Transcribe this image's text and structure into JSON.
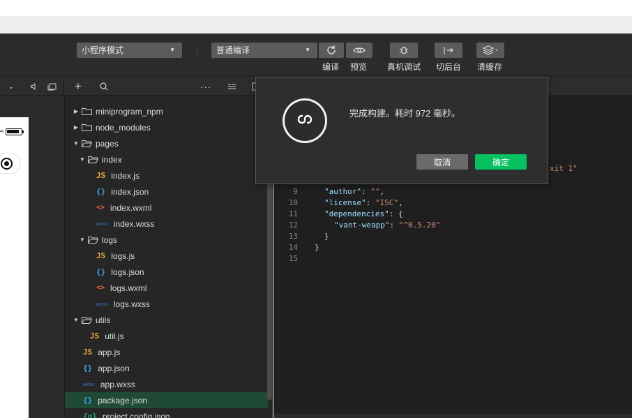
{
  "toolbar": {
    "mode_select": "小程序模式",
    "compile_select": "普通编译",
    "labels": {
      "compile": "编译",
      "preview": "预览",
      "remote_debug": "真机调试",
      "background": "切后台",
      "clear_cache": "清缓存"
    }
  },
  "tree": {
    "items": [
      {
        "label": "miniprogram_npm",
        "type": "folder",
        "expanded": false
      },
      {
        "label": "node_modules",
        "type": "folder",
        "expanded": false
      },
      {
        "label": "pages",
        "type": "folder",
        "expanded": true
      },
      {
        "label": "index",
        "type": "folder",
        "expanded": true
      },
      {
        "label": "index.js",
        "type": "js",
        "icon_text": "JS"
      },
      {
        "label": "index.json",
        "type": "json",
        "icon_text": "{}"
      },
      {
        "label": "index.wxml",
        "type": "wxml",
        "icon_text": "<>"
      },
      {
        "label": "index.wxss",
        "type": "wxss",
        "icon_text": "wxss"
      },
      {
        "label": "logs",
        "type": "folder",
        "expanded": true
      },
      {
        "label": "logs.js",
        "type": "js",
        "icon_text": "JS"
      },
      {
        "label": "logs.json",
        "type": "json",
        "icon_text": "{}"
      },
      {
        "label": "logs.wxml",
        "type": "wxml",
        "icon_text": "<>"
      },
      {
        "label": "logs.wxss",
        "type": "wxss",
        "icon_text": "wxss"
      },
      {
        "label": "utils",
        "type": "folder",
        "expanded": true
      },
      {
        "label": "util.js",
        "type": "js",
        "icon_text": "JS"
      },
      {
        "label": "app.js",
        "type": "js",
        "icon_text": "JS"
      },
      {
        "label": "app.json",
        "type": "json",
        "icon_text": "{}"
      },
      {
        "label": "app.wxss",
        "type": "wxss",
        "icon_text": "wxss"
      },
      {
        "label": "package.json",
        "type": "json",
        "icon_text": "{}",
        "active": true
      },
      {
        "label": "project.config.json",
        "type": "cfg",
        "icon_text": "{o}"
      }
    ]
  },
  "editor": {
    "line_numbers": [
      "9",
      "10",
      "11",
      "12",
      "13",
      "14",
      "15"
    ],
    "visible_fragment": "xit 1\"",
    "lines": {
      "l9_key": "\"author\"",
      "l9_val": "\"\"",
      "l10_key": "\"license\"",
      "l10_val": "\"ISC\"",
      "l11_key": "\"dependencies\"",
      "l12_key": "\"vant-weapp\"",
      "l12_val": "\"^0.5.20\"",
      "l13": "}",
      "l14": "}"
    }
  },
  "dialog": {
    "message": "完成构建。耗时 972 毫秒。",
    "cancel_label": "取消",
    "ok_label": "确定"
  },
  "colors": {
    "accent_green": "#07c160",
    "active_row": "#1e4a36"
  }
}
